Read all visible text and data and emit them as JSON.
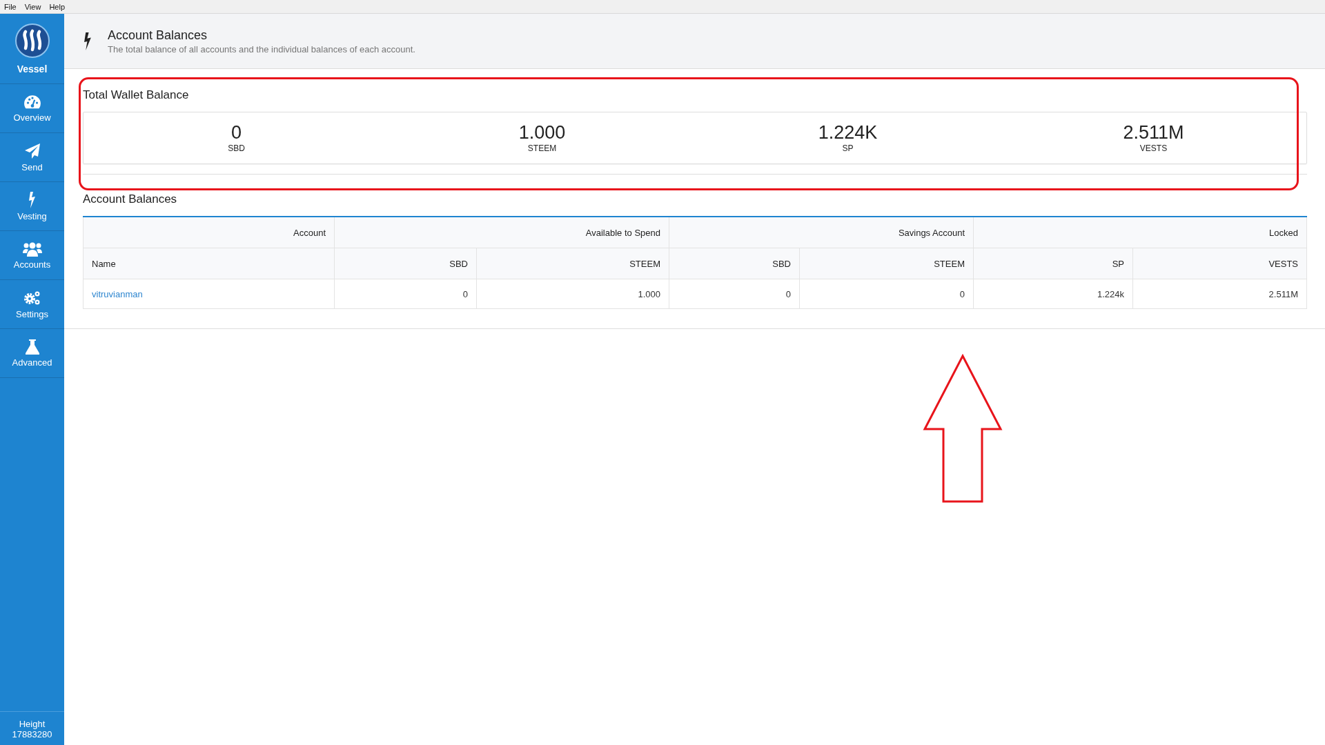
{
  "menu_bar": [
    "File",
    "View",
    "Help"
  ],
  "sidebar": {
    "brand": "Vessel",
    "items": [
      {
        "kind": "gauge",
        "label": "Overview"
      },
      {
        "kind": "send",
        "label": "Send"
      },
      {
        "kind": "bolt",
        "label": "Vesting"
      },
      {
        "kind": "users",
        "label": "Accounts"
      },
      {
        "kind": "gears",
        "label": "Settings"
      },
      {
        "kind": "flask",
        "label": "Advanced"
      }
    ],
    "footer": {
      "label": "Height",
      "value": "17883280"
    }
  },
  "header": {
    "title": "Account Balances",
    "subtitle": "The total balance of all accounts and the individual balances of each account."
  },
  "total_wallet": {
    "title": "Total Wallet Balance",
    "stats": [
      {
        "value": "0",
        "unit": "SBD"
      },
      {
        "value": "1.000",
        "unit": "STEEM"
      },
      {
        "value": "1.224K",
        "unit": "SP"
      },
      {
        "value": "2.511M",
        "unit": "VESTS"
      }
    ]
  },
  "account_balances": {
    "title": "Account Balances",
    "groups": [
      {
        "label": "Account",
        "columns": [
          "Name"
        ]
      },
      {
        "label": "Available to Spend",
        "columns": [
          "SBD",
          "STEEM"
        ]
      },
      {
        "label": "Savings Account",
        "columns": [
          "SBD",
          "STEEM"
        ]
      },
      {
        "label": "Locked",
        "columns": [
          "SP",
          "VESTS"
        ]
      }
    ],
    "rows": [
      [
        "vitruvianman",
        "0",
        "1.000",
        "0",
        "0",
        "1.224k",
        "2.511M"
      ]
    ]
  },
  "annotations": [
    {
      "kind": "highlight-box"
    },
    {
      "kind": "arrow"
    }
  ]
}
